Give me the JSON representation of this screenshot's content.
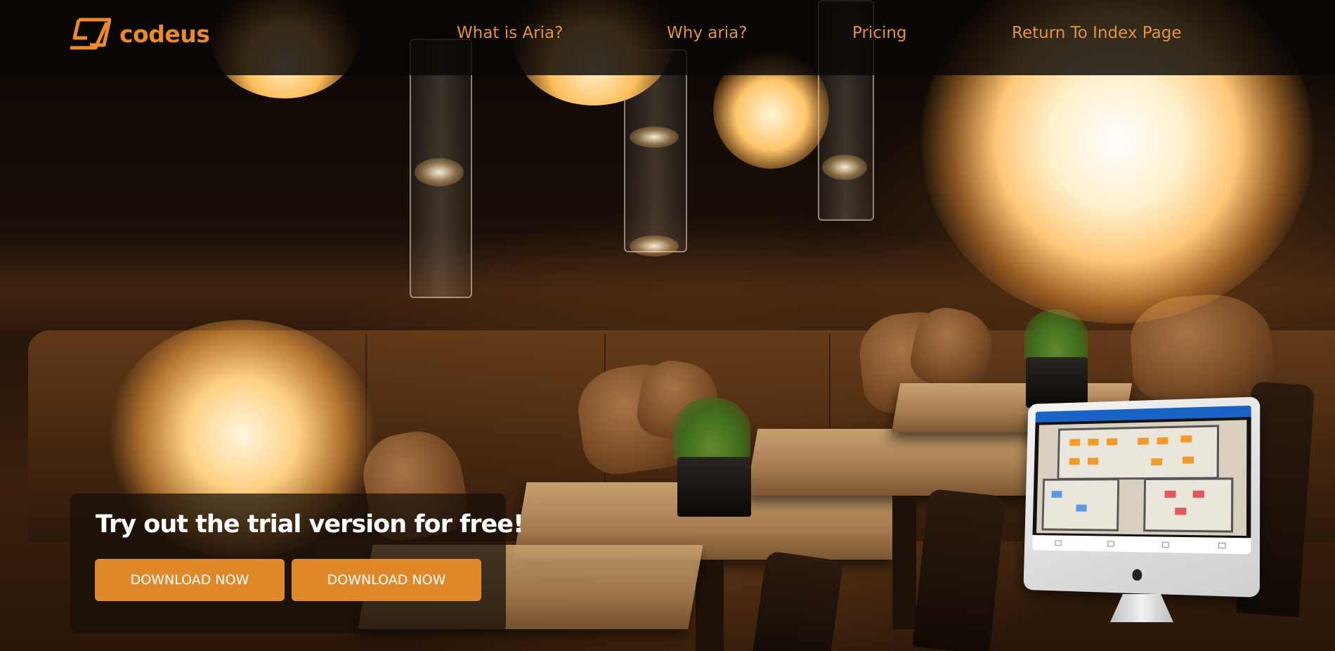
{
  "brand": {
    "name": "codeus",
    "color": "#e98a2c"
  },
  "nav": {
    "items": [
      {
        "label": "What is Aria?"
      },
      {
        "label": "Why aria?"
      },
      {
        "label": "Pricing"
      },
      {
        "label": "Return To Index Page"
      }
    ],
    "color": "#e0943f"
  },
  "hero": {
    "title": "Try out the trial version for free!",
    "buttons": [
      {
        "label": "DOWNLOAD NOW"
      },
      {
        "label": "DOWNLOAD NOW"
      }
    ],
    "button_color": "#e0892b"
  },
  "icons": [
    "logo-mark-icon",
    "apple-logo-icon"
  ]
}
